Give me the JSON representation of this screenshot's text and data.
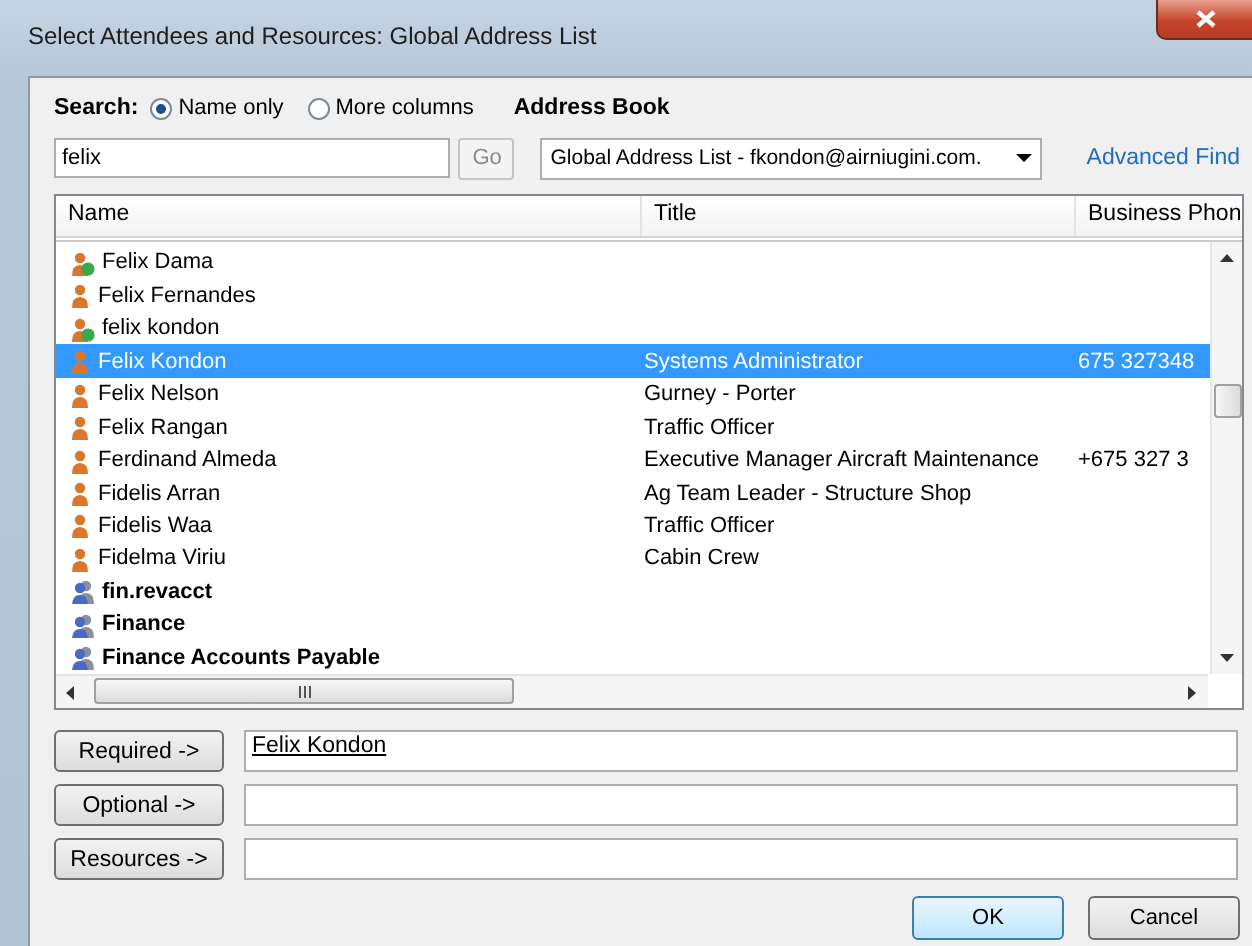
{
  "window": {
    "title": "Select Attendees and Resources: Global Address List"
  },
  "search": {
    "label": "Search:",
    "options": [
      {
        "label": "Name only",
        "selected": true
      },
      {
        "label": "More columns",
        "selected": false
      }
    ],
    "value": "felix",
    "go_button": "Go"
  },
  "address_book": {
    "label": "Address Book",
    "value": "Global Address List - fkondon@airniugini.com.",
    "link": "Advanced Find"
  },
  "table": {
    "columns": [
      "Name",
      "Title",
      "Business Phon"
    ],
    "rows": [
      {
        "kind": "remote",
        "name": "Felix Dama",
        "selected": false
      },
      {
        "kind": "person",
        "name": "Felix Fernandes",
        "selected": false
      },
      {
        "kind": "remote",
        "name": "felix kondon",
        "selected": false
      },
      {
        "kind": "person",
        "name": "Felix Kondon",
        "title": "Systems Administrator",
        "phone": "675 327348",
        "selected": true
      },
      {
        "kind": "person",
        "name": "Felix Nelson",
        "title": "Gurney - Porter",
        "selected": false
      },
      {
        "kind": "person",
        "name": "Felix Rangan",
        "title": "Traffic Officer",
        "selected": false
      },
      {
        "kind": "person",
        "name": "Ferdinand Almeda",
        "title": "Executive Manager Aircraft Maintenance",
        "phone": "+675 327 3",
        "selected": false
      },
      {
        "kind": "person",
        "name": "Fidelis Arran",
        "title": "Ag Team Leader - Structure Shop",
        "selected": false
      },
      {
        "kind": "person",
        "name": "Fidelis Waa",
        "title": "Traffic Officer",
        "selected": false
      },
      {
        "kind": "person",
        "name": "Fidelma Viriu",
        "title": "Cabin Crew",
        "selected": false
      },
      {
        "kind": "group",
        "name": "fin.revacct",
        "selected": false
      },
      {
        "kind": "group",
        "name": "Finance",
        "selected": false
      },
      {
        "kind": "group",
        "name": "Finance Accounts Payable",
        "selected": false
      }
    ]
  },
  "recipients": [
    {
      "button": "Required ->",
      "value": "Felix Kondon"
    },
    {
      "button": "Optional ->"
    },
    {
      "button": "Resources ->"
    }
  ],
  "buttons": [
    {
      "label": "OK",
      "default": true
    },
    {
      "label": "Cancel",
      "default": false
    }
  ]
}
